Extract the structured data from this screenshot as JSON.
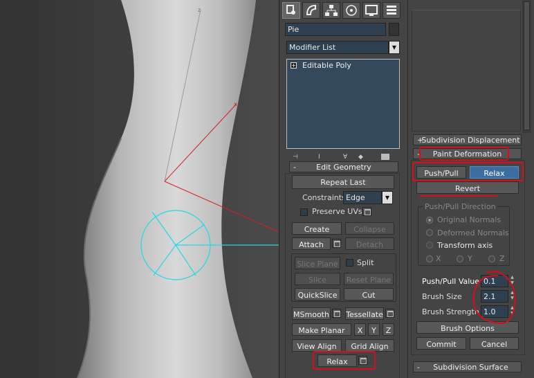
{
  "object_name": "Pie",
  "modifier_list": "Modifier List",
  "stack": [
    "Editable Poly"
  ],
  "colors": {
    "field_bg": "#2f4150",
    "selected": "#3d6d9e",
    "annotation": "#d4101c",
    "gizmo": "#22d8e8"
  },
  "toolbar_icons": [
    "create-icon",
    "modify-icon",
    "hierarchy-icon",
    "motion-icon",
    "display-icon",
    "utilities-icon"
  ],
  "edit_geometry": {
    "title": "Edit Geometry",
    "repeat_last": "Repeat Last",
    "constraints_label": "Constraints:",
    "constraints_value": "Edge",
    "preserve_uvs": "Preserve UVs",
    "create": "Create",
    "collapse": "Collapse",
    "attach": "Attach",
    "detach": "Detach",
    "slice_plane": "Slice Plane",
    "split": "Split",
    "slice": "Slice",
    "reset_plane": "Reset Plane",
    "quickslice": "QuickSlice",
    "cut": "Cut",
    "msmooth": "MSmooth",
    "tessellate": "Tessellate",
    "make_planar": "Make Planar",
    "x": "X",
    "y": "Y",
    "z": "Z",
    "view_align": "View Align",
    "grid_align": "Grid Align",
    "relax": "Relax"
  },
  "subdivision_displacement": {
    "sign": "+",
    "title": "Subdivision Displacement"
  },
  "paint_deformation": {
    "sign": "-",
    "title": "Paint Deformation",
    "push_pull": "Push/Pull",
    "relax": "Relax",
    "revert": "Revert",
    "direction_title": "Push/Pull Direction",
    "original_normals": "Original Normals",
    "deformed_normals": "Deformed Normals",
    "transform_axis": "Transform axis",
    "axis_x": "X",
    "axis_y": "Y",
    "axis_z": "Z",
    "push_pull_value_label": "Push/Pull Value",
    "push_pull_value": "0.1",
    "brush_size_label": "Brush Size",
    "brush_size": "2.1",
    "brush_strength_label": "Brush Strength",
    "brush_strength": "1.0",
    "brush_options": "Brush Options",
    "commit": "Commit",
    "cancel": "Cancel"
  },
  "subdivision_surface": {
    "sign": "-",
    "title": "Subdivision Surface"
  },
  "gizmo_axis_label": "z"
}
